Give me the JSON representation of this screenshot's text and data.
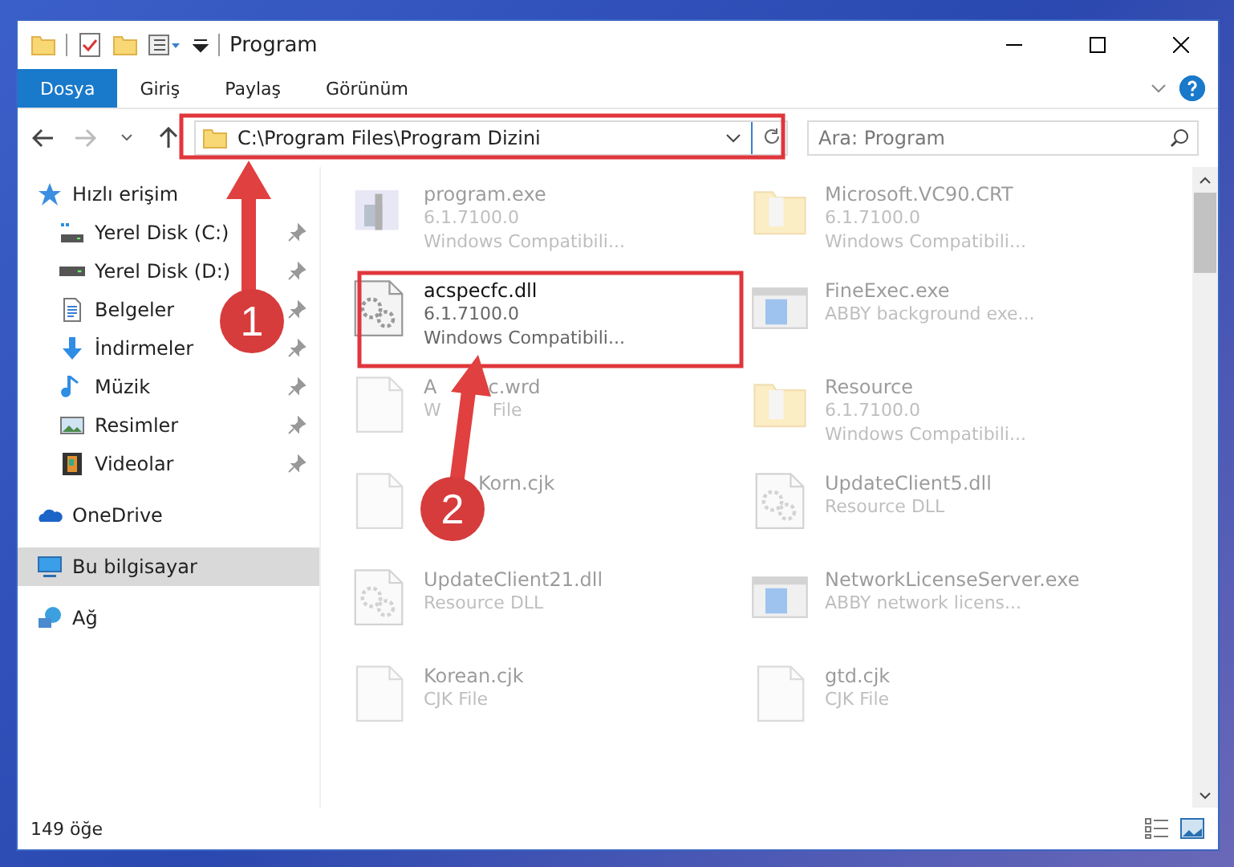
{
  "window": {
    "title": "Program"
  },
  "ribbon_tabs": [
    {
      "label": "Dosya",
      "selected": true
    },
    {
      "label": "Giriş",
      "selected": false
    },
    {
      "label": "Paylaş",
      "selected": false
    },
    {
      "label": "Görünüm",
      "selected": false
    }
  ],
  "address_bar": {
    "path": "C:\\Program Files\\Program Dizini"
  },
  "search": {
    "placeholder": "Ara: Program"
  },
  "sidebar": {
    "items": [
      {
        "label": "Hızlı erişim",
        "kind": "star",
        "selected": false,
        "children": [
          {
            "label": "Yerel Disk (C:)",
            "kind": "drive-c",
            "selected": false,
            "pinned": true
          },
          {
            "label": "Yerel Disk (D:)",
            "kind": "drive",
            "selected": false,
            "pinned": true
          },
          {
            "label": "Belgeler",
            "kind": "docs",
            "selected": false,
            "pinned": true
          },
          {
            "label": "İndirmeler",
            "kind": "download",
            "selected": false,
            "pinned": true
          },
          {
            "label": "Müzik",
            "kind": "music",
            "selected": false,
            "pinned": true
          },
          {
            "label": "Resimler",
            "kind": "pictures",
            "selected": false,
            "pinned": true
          },
          {
            "label": "Videolar",
            "kind": "videos",
            "selected": false,
            "pinned": true
          }
        ]
      },
      {
        "label": "OneDrive",
        "kind": "cloud",
        "selected": false
      },
      {
        "label": "Bu bilgisayar",
        "kind": "pc",
        "selected": true
      },
      {
        "label": "Ağ",
        "kind": "network",
        "selected": false
      }
    ]
  },
  "files": [
    {
      "name": "program.exe",
      "details": [
        "6.1.7100.0",
        "Windows Compatibili..."
      ],
      "kind": "exe",
      "blurred": true
    },
    {
      "name": "Microsoft.VC90.CRT",
      "details": [
        "6.1.7100.0",
        "Windows Compatibili..."
      ],
      "kind": "folder",
      "blurred": true
    },
    {
      "name": "acspecfc.dll",
      "details": [
        "6.1.7100.0",
        "Windows Compatibili..."
      ],
      "kind": "dll",
      "blurred": false
    },
    {
      "name": "FineExec.exe",
      "details": [
        "ABBY background exe..."
      ],
      "kind": "app",
      "blurred": true
    },
    {
      "name_parts": [
        "A",
        "c.wrd"
      ],
      "detail_parts": [
        "W",
        "File"
      ],
      "kind": "file",
      "blurred": true
    },
    {
      "name": "Resource",
      "details": [
        "6.1.7100.0",
        "Windows Compatibili..."
      ],
      "kind": "folder",
      "blurred": true
    },
    {
      "name": "Korn.cjk",
      "indented": true,
      "kind": "file",
      "blurred": true
    },
    {
      "name": "UpdateClient5.dll",
      "details": [
        "Resource DLL"
      ],
      "kind": "dll",
      "blurred": true
    },
    {
      "name": "UpdateClient21.dll",
      "details": [
        "Resource DLL"
      ],
      "kind": "dll",
      "blurred": true
    },
    {
      "name": "NetworkLicenseServer.exe",
      "details": [
        "ABBY network licens..."
      ],
      "kind": "app",
      "blurred": true
    },
    {
      "name": "Korean.cjk",
      "details": [
        "CJK File"
      ],
      "kind": "file",
      "blurred": true
    },
    {
      "name": "gtd.cjk",
      "details": [
        "CJK File"
      ],
      "kind": "file",
      "blurred": true
    }
  ],
  "status_bar": {
    "item_count": "149 öğe"
  },
  "annotations": [
    {
      "label": "1"
    },
    {
      "label": "2"
    }
  ]
}
